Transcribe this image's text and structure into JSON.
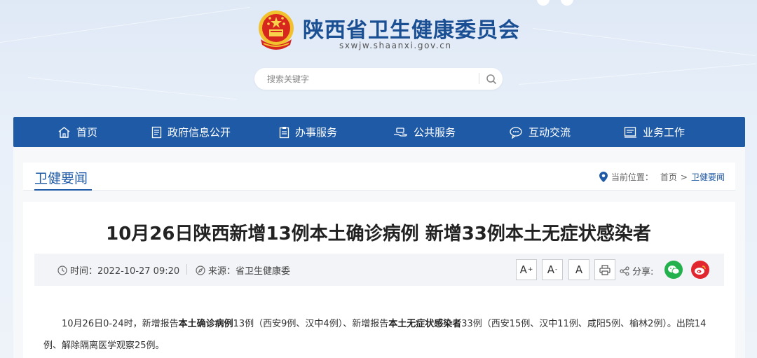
{
  "header": {
    "site_title": "陕西省卫生健康委员会",
    "domain": "sxwjw.shaanxi.gov.cn"
  },
  "search": {
    "placeholder": "搜索关键字"
  },
  "nav": {
    "items": [
      {
        "label": "首页",
        "icon": "home-icon"
      },
      {
        "label": "政府信息公开",
        "icon": "document-icon"
      },
      {
        "label": "办事服务",
        "icon": "clipboard-icon"
      },
      {
        "label": "公共服务",
        "icon": "hand-service-icon"
      },
      {
        "label": "互动交流",
        "icon": "chat-icon"
      },
      {
        "label": "业务工作",
        "icon": "briefcase-icon"
      }
    ]
  },
  "section": {
    "title": "卫健要闻",
    "location_label": "当前位置：",
    "crumb_home": "首页",
    "crumb_sep": ">",
    "crumb_current": "卫健要闻"
  },
  "article": {
    "title": "10月26日陕西新增13例本土确诊病例 新增33例本土无症状感染者",
    "time": "时间：2022-10-27 09:20",
    "source": "来源：省卫生健康委",
    "tools": {
      "font_up": "A",
      "font_up_mark": "+",
      "font_down": "A",
      "font_down_mark": "-",
      "font_reset": "A"
    },
    "share_label": "分享:",
    "body": {
      "p1_a": "10月26日0-24时，新增报告",
      "p1_b": "本土确诊病例",
      "p1_c": "13例（西安9例、汉中4例）、新增报告",
      "p1_d": "本土无症状感染者",
      "p1_e": "33例（西安15例、汉中11例、咸阳5例、榆林2例）。出院14例、解除隔离医学观察25例。"
    }
  },
  "colors": {
    "brand_blue": "#1f5aa6",
    "wechat_green": "#22b14c",
    "weibo_red": "#e2262f"
  }
}
